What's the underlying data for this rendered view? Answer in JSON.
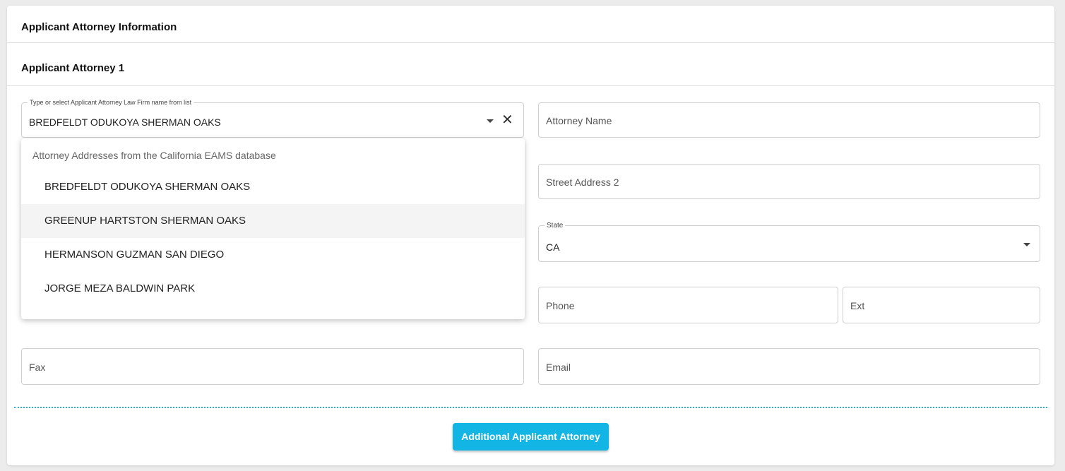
{
  "header": {
    "title": "Applicant Attorney Information"
  },
  "attorney1": {
    "title": "Applicant Attorney 1",
    "law_firm": {
      "floating_label": "Type or select Applicant Attorney Law Firm name from list",
      "value": "BREDFELDT ODUKOYA SHERMAN OAKS"
    },
    "dropdown": {
      "group_label": "Attorney Addresses from the California EAMS database",
      "options": [
        "BREDFELDT ODUKOYA SHERMAN OAKS",
        "GREENUP HARTSTON SHERMAN OAKS",
        "HERMANSON GUZMAN SAN DIEGO",
        "JORGE MEZA BALDWIN PARK"
      ],
      "highlighted_index": 1
    },
    "attorney_name": {
      "placeholder": "Attorney Name"
    },
    "street_address_2": {
      "placeholder": "Street Address 2"
    },
    "state": {
      "floating_label": "State",
      "value": "CA"
    },
    "phone": {
      "placeholder": "Phone"
    },
    "ext": {
      "placeholder": "Ext"
    },
    "fax": {
      "placeholder": "Fax"
    },
    "email": {
      "placeholder": "Email"
    }
  },
  "actions": {
    "additional_attorney_label": "Additional Applicant Attorney"
  },
  "colors": {
    "accent": "#12b5e3",
    "divider_dotted": "#2ab0d8"
  },
  "icons": {
    "dropdown": "caret-down-icon",
    "clear": "close-icon"
  }
}
